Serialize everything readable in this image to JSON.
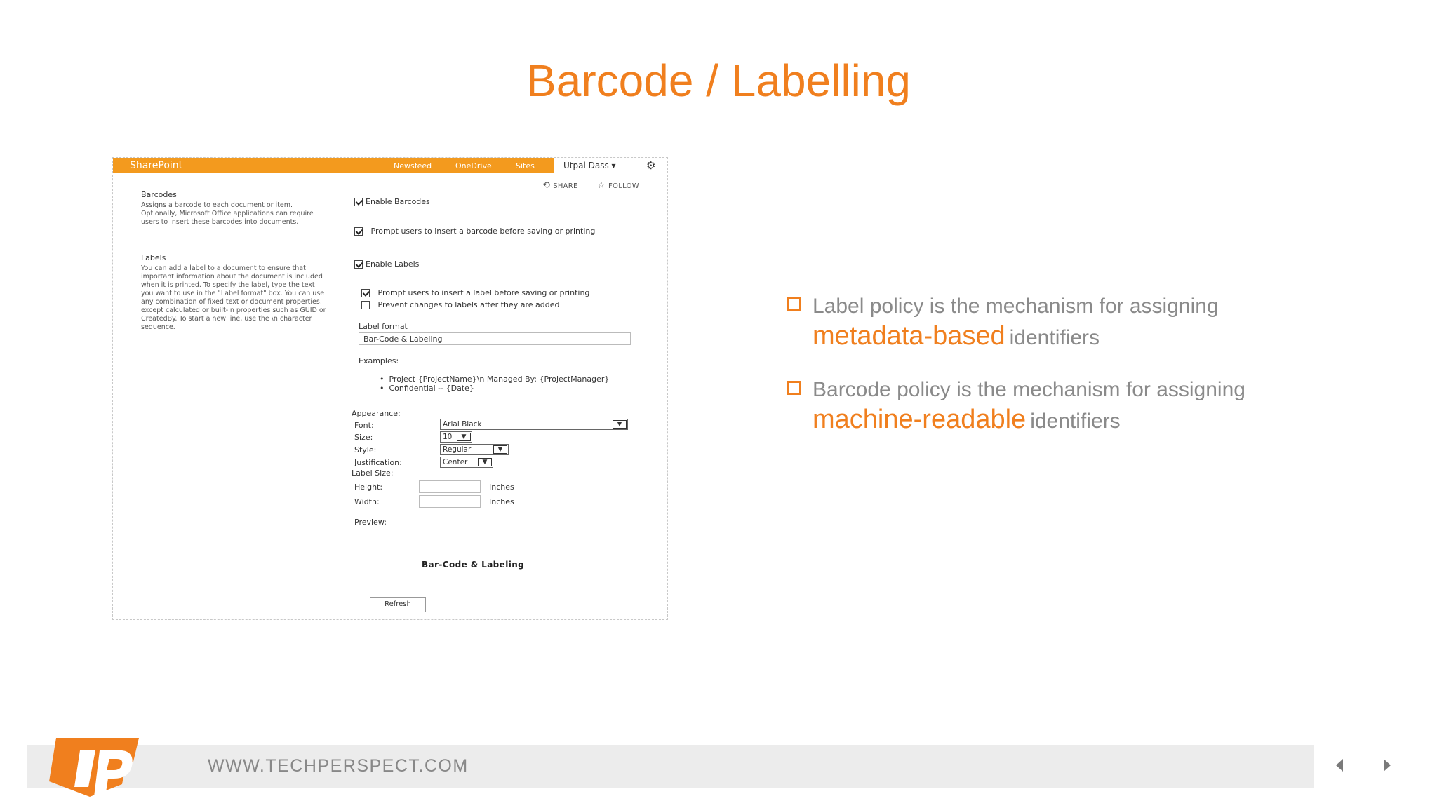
{
  "slide": {
    "title": "Barcode / Labelling",
    "footer_url": "WWW.TECHPERSPECT.COM",
    "accent_color": "#f07f1e"
  },
  "sharepoint": {
    "brand": "SharePoint",
    "nav": [
      "Newsfeed",
      "OneDrive",
      "Sites"
    ],
    "user": "Utpal Dass ▾",
    "share": "SHARE",
    "follow": "FOLLOW",
    "barcodes": {
      "heading": "Barcodes",
      "desc": "Assigns a barcode to each document or item. Optionally, Microsoft Office applications can require users to insert these barcodes into documents.",
      "enable": "Enable Barcodes",
      "prompt": "Prompt users to insert a barcode before saving or printing"
    },
    "labels": {
      "heading": "Labels",
      "desc": "You can add a label to a document to ensure that important information about the document is included when it is printed. To specify the label, type the text you want to use in the \"Label format\" box. You can use any combination of fixed text or document properties, except calculated or built-in properties such as GUID or CreatedBy. To start a new line, use the \\n character sequence.",
      "enable": "Enable Labels",
      "prompt": "Prompt users to insert a label before saving or printing",
      "prevent": "Prevent changes to labels after they are added",
      "format_label": "Label format",
      "format_value": "Bar-Code & Labeling",
      "examples_label": "Examples:",
      "examples": [
        "Project {ProjectName}\\n Managed By: {ProjectManager}",
        "Confidential -- {Date}"
      ]
    },
    "appearance": {
      "heading": "Appearance:",
      "font_label": "Font:",
      "font_value": "Arial Black",
      "size_label": "Size:",
      "size_value": "10",
      "style_label": "Style:",
      "style_value": "Regular",
      "justification_label": "Justification:",
      "justification_value": "Center",
      "label_size": "Label Size:",
      "height_label": "Height:",
      "width_label": "Width:",
      "inches": "Inches",
      "preview_label": "Preview:",
      "preview_text": "Bar-Code & Labeling",
      "refresh": "Refresh"
    }
  },
  "bullets": [
    {
      "line1": "Label policy is the mechanism for assigning",
      "highlight": "metadata-based",
      "rest": "identifiers"
    },
    {
      "line1": "Barcode policy is the mechanism for assigning",
      "highlight": "machine-readable",
      "rest": "identifiers"
    }
  ],
  "icons": {
    "settings": "gear-icon",
    "share": "share-icon",
    "follow": "star-icon",
    "prev": "prev-arrow-icon",
    "next": "next-arrow-icon"
  }
}
